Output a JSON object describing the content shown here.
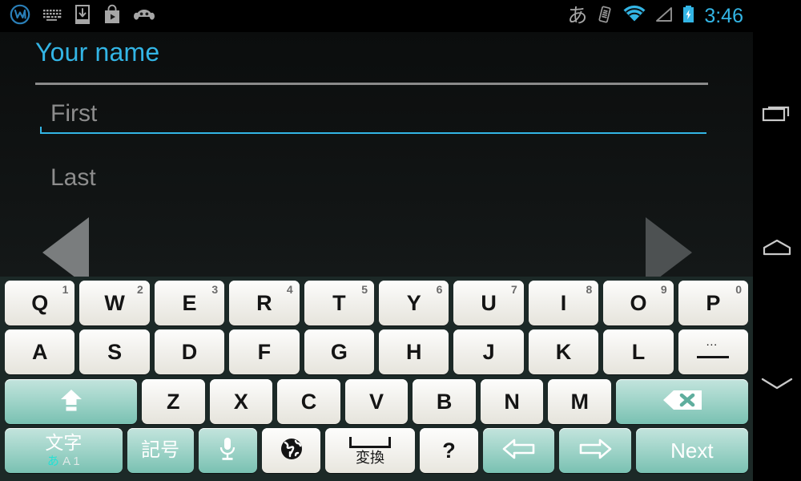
{
  "statusbar": {
    "left_icons": [
      {
        "name": "app-w-icon",
        "glyph": "w"
      },
      {
        "name": "keyboard-icon",
        "glyph": "keyboard"
      },
      {
        "name": "download-icon",
        "glyph": "download"
      },
      {
        "name": "play-store-icon",
        "glyph": "bag"
      },
      {
        "name": "android-head-icon",
        "glyph": "android"
      }
    ],
    "right_icons": [
      {
        "name": "ime-japanese-icon",
        "glyph": "あ"
      },
      {
        "name": "vibrate-icon",
        "glyph": "vibrate"
      },
      {
        "name": "wifi-icon",
        "glyph": "wifi"
      },
      {
        "name": "signal-icon",
        "glyph": "signal"
      },
      {
        "name": "battery-charging-icon",
        "glyph": "battery"
      }
    ],
    "clock": "3:46",
    "accent_color": "#33b5e5"
  },
  "content": {
    "title": "Your name",
    "fields": [
      {
        "name": "first-name",
        "placeholder": "First",
        "value": "",
        "focused": true
      },
      {
        "name": "last-name",
        "placeholder": "Last",
        "value": "",
        "focused": false
      }
    ],
    "nav_prev_label": "Previous",
    "nav_next_label": "Next"
  },
  "sysnav": {
    "items": [
      {
        "name": "recents-button",
        "icon": "recents-icon"
      },
      {
        "name": "home-button",
        "icon": "home-icon"
      },
      {
        "name": "hide-keyboard-button",
        "icon": "chevron-down-icon"
      }
    ]
  },
  "keyboard": {
    "background_color": "#1c2927",
    "teal_key_color": "#a2d5ca",
    "rows": [
      [
        {
          "name": "key-q",
          "label": "Q",
          "alt": "1",
          "style": "light"
        },
        {
          "name": "key-w",
          "label": "W",
          "alt": "2",
          "style": "light"
        },
        {
          "name": "key-e",
          "label": "E",
          "alt": "3",
          "style": "light"
        },
        {
          "name": "key-r",
          "label": "R",
          "alt": "4",
          "style": "light"
        },
        {
          "name": "key-t",
          "label": "T",
          "alt": "5",
          "style": "light"
        },
        {
          "name": "key-y",
          "label": "Y",
          "alt": "6",
          "style": "light"
        },
        {
          "name": "key-u",
          "label": "U",
          "alt": "7",
          "style": "light"
        },
        {
          "name": "key-i",
          "label": "I",
          "alt": "8",
          "style": "light"
        },
        {
          "name": "key-o",
          "label": "O",
          "alt": "9",
          "style": "light"
        },
        {
          "name": "key-p",
          "label": "P",
          "alt": "0",
          "style": "light"
        }
      ],
      [
        {
          "name": "key-a",
          "label": "A",
          "alt": "",
          "style": "light"
        },
        {
          "name": "key-s",
          "label": "S",
          "alt": "",
          "style": "light"
        },
        {
          "name": "key-d",
          "label": "D",
          "alt": "",
          "style": "light"
        },
        {
          "name": "key-f",
          "label": "F",
          "alt": "",
          "style": "light"
        },
        {
          "name": "key-g",
          "label": "G",
          "alt": "",
          "style": "light"
        },
        {
          "name": "key-h",
          "label": "H",
          "alt": "",
          "style": "light"
        },
        {
          "name": "key-j",
          "label": "J",
          "alt": "",
          "style": "light"
        },
        {
          "name": "key-k",
          "label": "K",
          "alt": "",
          "style": "light"
        },
        {
          "name": "key-l",
          "label": "L",
          "alt": "",
          "style": "light"
        },
        {
          "name": "key-symbols-more",
          "label": "—",
          "alt": "…",
          "style": "light",
          "icon": "dots-dash-icon"
        }
      ],
      [
        {
          "name": "key-shift",
          "label": "",
          "alt": "",
          "style": "teal",
          "icon": "shift-up-arrow-icon",
          "flex": 2.1
        },
        {
          "name": "key-z",
          "label": "Z",
          "alt": "",
          "style": "light"
        },
        {
          "name": "key-x",
          "label": "X",
          "alt": "",
          "style": "light"
        },
        {
          "name": "key-c",
          "label": "C",
          "alt": "",
          "style": "light"
        },
        {
          "name": "key-v",
          "label": "V",
          "alt": "",
          "style": "light"
        },
        {
          "name": "key-b",
          "label": "B",
          "alt": "",
          "style": "light"
        },
        {
          "name": "key-n",
          "label": "N",
          "alt": "",
          "style": "light"
        },
        {
          "name": "key-m",
          "label": "M",
          "alt": "",
          "style": "light"
        },
        {
          "name": "key-backspace",
          "label": "",
          "alt": "",
          "style": "teal",
          "icon": "backspace-icon",
          "flex": 2.1
        }
      ],
      [
        {
          "name": "key-mode-moji",
          "label": "文字",
          "alt": "あ A 1",
          "style": "teal",
          "flex": 2.3
        },
        {
          "name": "key-symbols",
          "label": "記号",
          "alt": "",
          "style": "teal",
          "flex": 1.3
        },
        {
          "name": "key-voice-input",
          "label": "",
          "alt": "",
          "style": "teal",
          "icon": "microphone-icon",
          "flex": 1.15
        },
        {
          "name": "key-language-switch",
          "label": "",
          "alt": "",
          "style": "light",
          "icon": "globe-icon",
          "flex": 1.15
        },
        {
          "name": "key-space-henkan",
          "label": "変換",
          "alt": "",
          "style": "light",
          "icon": "space-bar-icon",
          "flex": 1.75
        },
        {
          "name": "key-question",
          "label": "?",
          "alt": "",
          "style": "light",
          "flex": 1.15
        },
        {
          "name": "key-arrow-left",
          "label": "",
          "alt": "",
          "style": "teal",
          "icon": "arrow-left-icon",
          "flex": 1.4
        },
        {
          "name": "key-arrow-right",
          "label": "",
          "alt": "",
          "style": "teal",
          "icon": "arrow-right-icon",
          "flex": 1.4
        },
        {
          "name": "key-next",
          "label": "Next",
          "alt": "",
          "style": "teal",
          "flex": 2.2
        }
      ]
    ]
  }
}
